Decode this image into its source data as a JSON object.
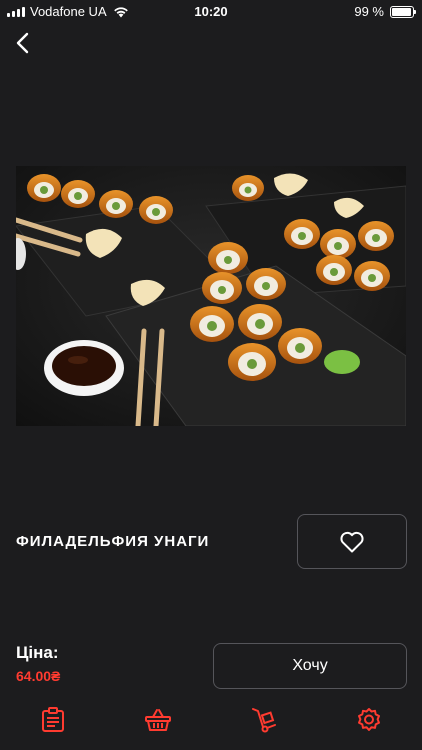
{
  "status_bar": {
    "carrier": "Vodafone UA",
    "time": "10:20",
    "battery": "99 %",
    "battery_level": 0.99
  },
  "product": {
    "title": "ФИЛАДЕЛЬФИЯ УНАГИ",
    "price_label": "Ціна:",
    "price": "64.00₴"
  },
  "actions": {
    "order_label": "Хочу"
  },
  "colors": {
    "background": "#1c1c1e",
    "accent": "#ff3b30",
    "border": "#55555a"
  },
  "tabs": [
    {
      "icon": "menu-list-icon"
    },
    {
      "icon": "basket-icon"
    },
    {
      "icon": "delivery-cart-icon"
    },
    {
      "icon": "settings-gear-icon"
    }
  ]
}
